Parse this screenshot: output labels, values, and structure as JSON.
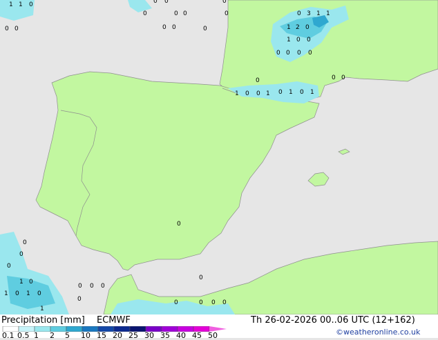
{
  "map": {
    "colors": {
      "sea": "#e6e6e6",
      "land": "#c2f7a0",
      "precip_light": "#9ae7ee",
      "precip_medium": "#5fcde0",
      "precip_heavy": "#2fa8d0",
      "border": "#8e8e8e"
    },
    "values": [
      {
        "v": "1"
      },
      {
        "v": "1"
      },
      {
        "v": "0"
      },
      {
        "v": "0"
      },
      {
        "v": "0"
      },
      {
        "v": "0"
      },
      {
        "v": "0"
      },
      {
        "v": "0"
      },
      {
        "v": "0"
      },
      {
        "v": "0"
      },
      {
        "v": "0"
      },
      {
        "v": "0"
      },
      {
        "v": "0"
      },
      {
        "v": "0"
      },
      {
        "v": "0"
      },
      {
        "v": "0"
      },
      {
        "v": "3"
      },
      {
        "v": "1"
      },
      {
        "v": "1"
      },
      {
        "v": "1"
      },
      {
        "v": "2"
      },
      {
        "v": "0"
      },
      {
        "v": "1"
      },
      {
        "v": "0"
      },
      {
        "v": "0"
      },
      {
        "v": "0"
      },
      {
        "v": "0"
      },
      {
        "v": "0"
      },
      {
        "v": "0"
      },
      {
        "v": "0"
      },
      {
        "v": "1"
      },
      {
        "v": "0"
      },
      {
        "v": "0"
      },
      {
        "v": "1"
      },
      {
        "v": "0"
      },
      {
        "v": "1"
      },
      {
        "v": "0"
      },
      {
        "v": "1"
      },
      {
        "v": "0"
      },
      {
        "v": "0"
      },
      {
        "v": "0"
      },
      {
        "v": "0"
      },
      {
        "v": "0"
      },
      {
        "v": "0"
      },
      {
        "v": "1"
      },
      {
        "v": "0"
      },
      {
        "v": "1"
      },
      {
        "v": "0"
      },
      {
        "v": "1"
      },
      {
        "v": "0"
      },
      {
        "v": "1"
      },
      {
        "v": "0"
      },
      {
        "v": "0"
      },
      {
        "v": "0"
      },
      {
        "v": "0"
      },
      {
        "v": "0"
      },
      {
        "v": "0"
      },
      {
        "v": "0"
      },
      {
        "v": "0"
      },
      {
        "v": "0"
      }
    ]
  },
  "footer": {
    "title": "Precipitation [mm]",
    "model": "ECMWF",
    "datetime": "Th 26-02-2026 00..06 UTC (12+162)",
    "credit": "©weatheronline.co.uk",
    "scale": [
      {
        "label": "0.1",
        "color": "#ffffff"
      },
      {
        "label": "0.5",
        "color": "#c8f4fa"
      },
      {
        "label": "1",
        "color": "#9ae7ee"
      },
      {
        "label": "2",
        "color": "#5fcde0"
      },
      {
        "label": "5",
        "color": "#2fa8d0"
      },
      {
        "label": "10",
        "color": "#1a78c0"
      },
      {
        "label": "15",
        "color": "#1448a8"
      },
      {
        "label": "20",
        "color": "#0c2a90"
      },
      {
        "label": "25",
        "color": "#0a1570"
      },
      {
        "label": "30",
        "color": "#7a00c8"
      },
      {
        "label": "35",
        "color": "#a000d8"
      },
      {
        "label": "40",
        "color": "#c800e0"
      },
      {
        "label": "45",
        "color": "#e400d8"
      },
      {
        "label": "50",
        "color": "#f060e0"
      }
    ]
  }
}
